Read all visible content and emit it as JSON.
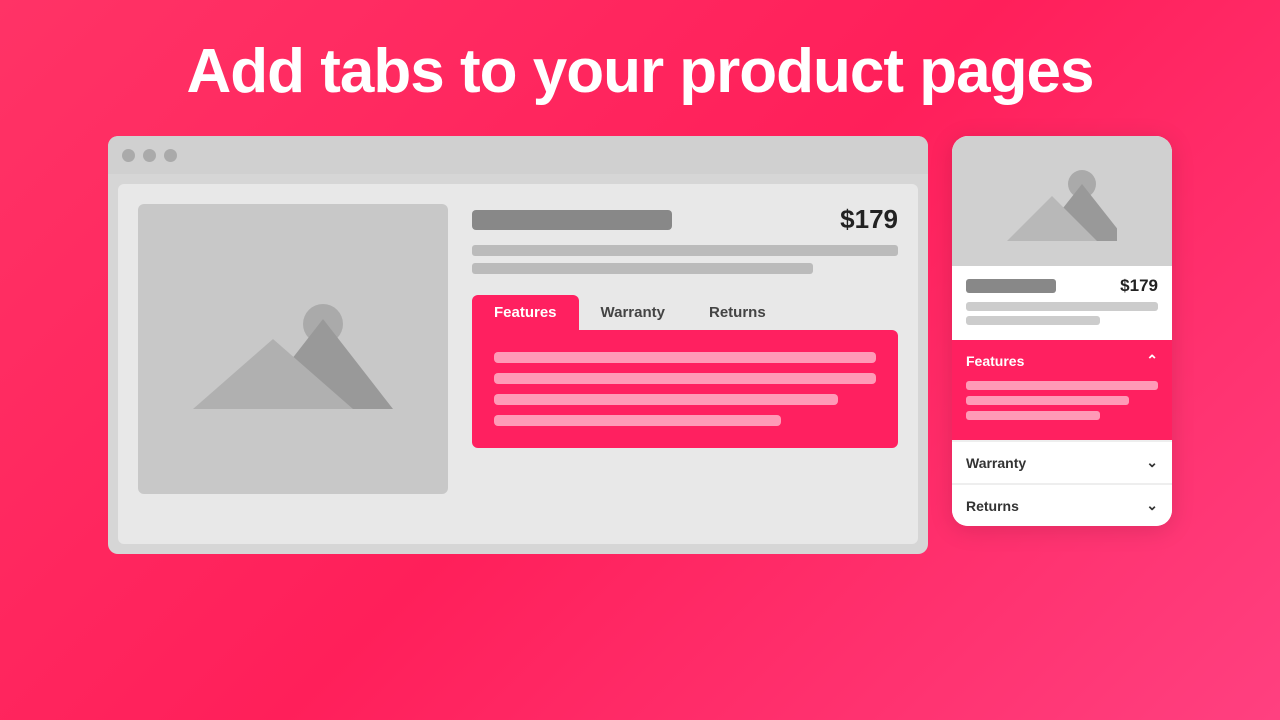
{
  "headline": "Add tabs to your product pages",
  "browser": {
    "price": "$179",
    "tabs": [
      {
        "label": "Features",
        "active": true
      },
      {
        "label": "Warranty",
        "active": false
      },
      {
        "label": "Returns",
        "active": false
      }
    ]
  },
  "mobile": {
    "price": "$179",
    "accordion": [
      {
        "label": "Features",
        "active": true,
        "chevron": "^"
      },
      {
        "label": "Warranty",
        "active": false,
        "chevron": "v"
      },
      {
        "label": "Returns",
        "active": false,
        "chevron": "v"
      }
    ]
  }
}
